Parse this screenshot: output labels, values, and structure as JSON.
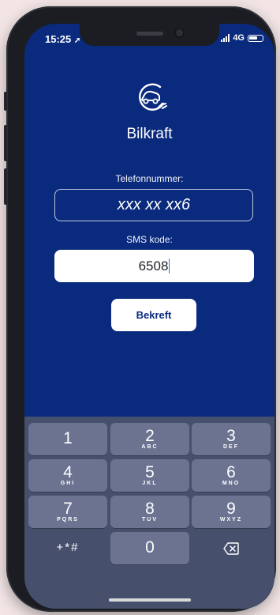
{
  "status_bar": {
    "time": "15:25",
    "network": "4G"
  },
  "app": {
    "name": "Bilkraft"
  },
  "form": {
    "phone_label": "Telefonnummer:",
    "phone_value": "xxx xx xx6",
    "sms_label": "SMS kode:",
    "sms_value": "6508",
    "confirm_label": "Bekreft"
  },
  "keypad": {
    "keys": [
      {
        "num": "1",
        "letters": ""
      },
      {
        "num": "2",
        "letters": "ABC"
      },
      {
        "num": "3",
        "letters": "DEF"
      },
      {
        "num": "4",
        "letters": "GHI"
      },
      {
        "num": "5",
        "letters": "JKL"
      },
      {
        "num": "6",
        "letters": "MNO"
      },
      {
        "num": "7",
        "letters": "PQRS"
      },
      {
        "num": "8",
        "letters": "TUV"
      },
      {
        "num": "9",
        "letters": "WXYZ"
      },
      {
        "num": "0",
        "letters": ""
      }
    ],
    "symbols_label": "+*#"
  },
  "colors": {
    "background": "#0a2a7e",
    "keyboard": "#46506c",
    "key": "#6b7391"
  }
}
